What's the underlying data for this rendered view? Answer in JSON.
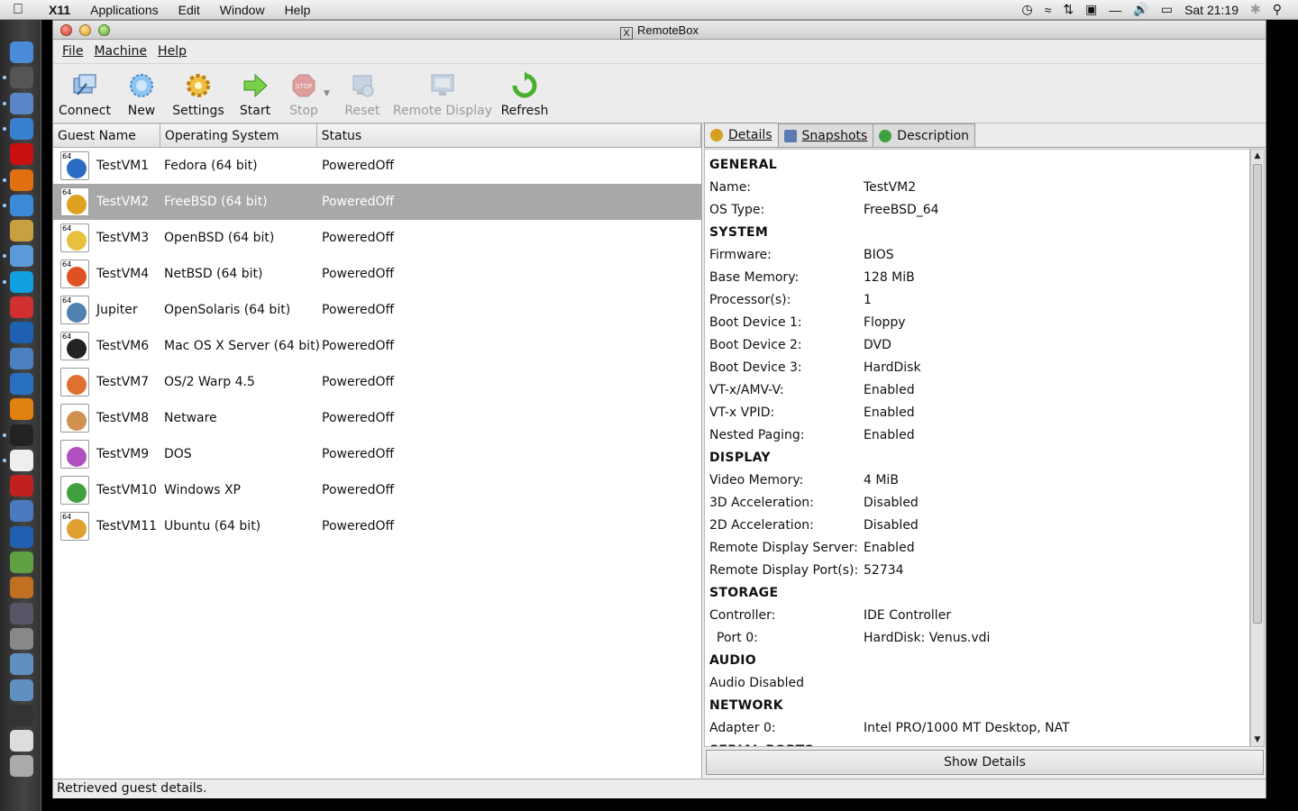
{
  "mac_menubar": {
    "app_name": "X11",
    "menus": [
      "Applications",
      "Edit",
      "Window",
      "Help"
    ],
    "clock": "Sat 21:19"
  },
  "window": {
    "title": "RemoteBox",
    "menu": [
      {
        "label": "File"
      },
      {
        "label": "Machine"
      },
      {
        "label": "Help"
      }
    ]
  },
  "toolbar": {
    "connect": "Connect",
    "new": "New",
    "settings": "Settings",
    "start": "Start",
    "stop": "Stop",
    "reset": "Reset",
    "remote_display": "Remote Display",
    "refresh": "Refresh"
  },
  "guest_list": {
    "columns": [
      "Guest Name",
      "Operating System",
      "Status"
    ],
    "rows": [
      {
        "name": "TestVM1",
        "os": "Fedora (64 bit)",
        "status": "PoweredOff",
        "badge": "64",
        "color": "#2b6cc4"
      },
      {
        "name": "TestVM2",
        "os": "FreeBSD (64 bit)",
        "status": "PoweredOff",
        "badge": "64",
        "color": "#e0a020"
      },
      {
        "name": "TestVM3",
        "os": "OpenBSD (64 bit)",
        "status": "PoweredOff",
        "badge": "64",
        "color": "#e8c040"
      },
      {
        "name": "TestVM4",
        "os": "NetBSD (64 bit)",
        "status": "PoweredOff",
        "badge": "64",
        "color": "#e05020"
      },
      {
        "name": "Jupiter",
        "os": "OpenSolaris (64 bit)",
        "status": "PoweredOff",
        "badge": "64",
        "color": "#5080b0"
      },
      {
        "name": "TestVM6",
        "os": "Mac OS X Server (64 bit)",
        "status": "PoweredOff",
        "badge": "64",
        "color": "#222222"
      },
      {
        "name": "TestVM7",
        "os": "OS/2 Warp 4.5",
        "status": "PoweredOff",
        "badge": "",
        "color": "#e07030"
      },
      {
        "name": "TestVM8",
        "os": "Netware",
        "status": "PoweredOff",
        "badge": "",
        "color": "#d09050"
      },
      {
        "name": "TestVM9",
        "os": "DOS",
        "status": "PoweredOff",
        "badge": "",
        "color": "#b050c0"
      },
      {
        "name": "TestVM10",
        "os": "Windows XP",
        "status": "PoweredOff",
        "badge": "",
        "color": "#40a040"
      },
      {
        "name": "TestVM11",
        "os": "Ubuntu (64 bit)",
        "status": "PoweredOff",
        "badge": "64",
        "color": "#e0a030"
      }
    ],
    "selected_index": 1
  },
  "tabs": [
    {
      "label": "Details",
      "color": "#d4a020"
    },
    {
      "label": "Snapshots",
      "color": "#5a7ab0"
    },
    {
      "label": "Description",
      "color": "#3fa040"
    }
  ],
  "details": [
    {
      "section": "GENERAL"
    },
    {
      "key": "Name:",
      "value": "TestVM2"
    },
    {
      "key": "OS Type:",
      "value": "FreeBSD_64"
    },
    {
      "section": "SYSTEM"
    },
    {
      "key": "Firmware:",
      "value": "BIOS"
    },
    {
      "key": "Base Memory:",
      "value": "128 MiB"
    },
    {
      "key": "Processor(s):",
      "value": "1"
    },
    {
      "key": "Boot Device 1:",
      "value": "Floppy"
    },
    {
      "key": "Boot Device 2:",
      "value": "DVD"
    },
    {
      "key": "Boot Device 3:",
      "value": "HardDisk"
    },
    {
      "key": "VT-x/AMV-V:",
      "value": "Enabled"
    },
    {
      "key": "VT-x VPID:",
      "value": "Enabled"
    },
    {
      "key": "Nested Paging:",
      "value": "Enabled"
    },
    {
      "section": "DISPLAY"
    },
    {
      "key": "Video Memory:",
      "value": "4 MiB"
    },
    {
      "key": "3D Acceleration:",
      "value": "Disabled"
    },
    {
      "key": "2D Acceleration:",
      "value": "Disabled"
    },
    {
      "key": "Remote Display Server:",
      "value": "Enabled"
    },
    {
      "key": "Remote Display Port(s):",
      "value": "52734"
    },
    {
      "section": "STORAGE"
    },
    {
      "key": "Controller:",
      "value": "IDE Controller"
    },
    {
      "key": "Port 0:",
      "value": "HardDisk: Venus.vdi",
      "indent": true
    },
    {
      "section": "AUDIO"
    },
    {
      "key": "Audio Disabled",
      "value": ""
    },
    {
      "section": "NETWORK"
    },
    {
      "key": "Adapter 0:",
      "value": "Intel PRO/1000 MT Desktop, NAT"
    },
    {
      "section": "SERIAL PORTS"
    }
  ],
  "show_details_label": "Show Details",
  "status_text": "Retrieved guest details.",
  "dock_icons": [
    {
      "name": "finder-icon",
      "color": "#4a8ad8"
    },
    {
      "name": "dashboard-icon",
      "color": "#555"
    },
    {
      "name": "preview-icon",
      "color": "#5a86c8"
    },
    {
      "name": "safari-icon",
      "color": "#3a80d0"
    },
    {
      "name": "opera-icon",
      "color": "#c81010"
    },
    {
      "name": "firefox-icon",
      "color": "#e07010"
    },
    {
      "name": "ichat-icon",
      "color": "#3a8ad8"
    },
    {
      "name": "mail-icon",
      "color": "#c8a040"
    },
    {
      "name": "itunes-icon",
      "color": "#5a9ad8"
    },
    {
      "name": "skype-icon",
      "color": "#10a0e0"
    },
    {
      "name": "ical-icon",
      "color": "#d03030"
    },
    {
      "name": "earth-icon",
      "color": "#2060b0"
    },
    {
      "name": "globe-icon",
      "color": "#4a80c0"
    },
    {
      "name": "quicktime-icon",
      "color": "#2a70c0"
    },
    {
      "name": "vlc-icon",
      "color": "#e08010"
    },
    {
      "name": "terminal-icon",
      "color": "#222"
    },
    {
      "name": "x11-icon",
      "color": "#eee"
    },
    {
      "name": "acrobat-icon",
      "color": "#c02020"
    },
    {
      "name": "preview-icon-2",
      "color": "#4a7ac0"
    },
    {
      "name": "word-icon",
      "color": "#2060b0"
    },
    {
      "name": "mindmap-icon",
      "color": "#60a040"
    },
    {
      "name": "app-icon",
      "color": "#c07020"
    },
    {
      "name": "timemachine-icon",
      "color": "#556"
    },
    {
      "name": "syspref-icon",
      "color": "#888"
    },
    {
      "name": "folder-icon",
      "color": "#6090c0"
    },
    {
      "name": "folder-icon-2",
      "color": "#6090c0"
    },
    {
      "name": "console-icon",
      "color": "#333"
    },
    {
      "name": "document-icon",
      "color": "#ddd"
    },
    {
      "name": "trash-icon",
      "color": "#aaa"
    }
  ]
}
